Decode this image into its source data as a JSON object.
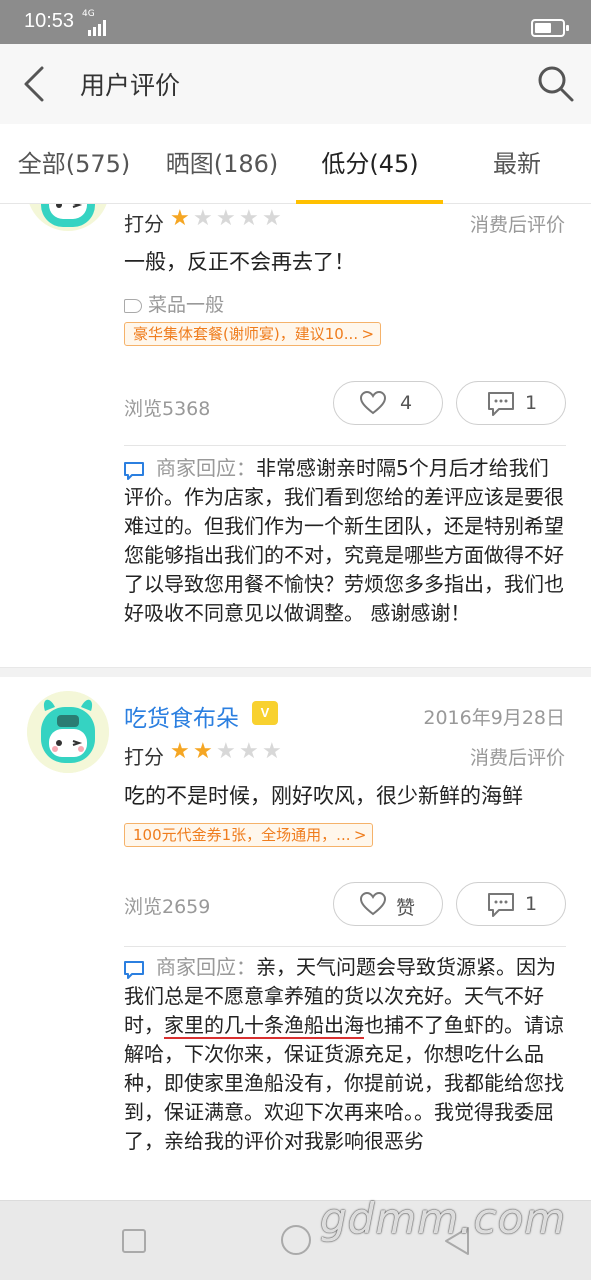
{
  "status_bar": {
    "time": "10:53",
    "network": "4G"
  },
  "header": {
    "title": "用户评价"
  },
  "tabs": [
    {
      "label": "全部(575)"
    },
    {
      "label": "晒图(186)"
    },
    {
      "label": "低分(45)",
      "active": true
    },
    {
      "label": "最新"
    }
  ],
  "reviews": [
    {
      "score_label": "打分",
      "stars": 1,
      "tag": "消费后评价",
      "text": "一般，反正不会再去了！",
      "dish_tag": "菜品一般",
      "deal": "豪华集体套餐(谢师宴)，建议10...",
      "views": "浏览5368",
      "like_count": "4",
      "comment_count": "1",
      "reply_label": "商家回应：",
      "reply_text": "非常感谢亲时隔5个月后才给我们评价。作为店家，我们看到您给的差评应该是要很难过的。但我们作为一个新生团队，还是特别希望您能够指出我们的不对，究竟是哪些方面做得不好了以导致您用餐不愉快？劳烦您多多指出，我们也好吸收不同意见以做调整。 感谢感谢！"
    },
    {
      "username": "吃货食布朵",
      "vip": "V",
      "date": "2016年9月28日",
      "score_label": "打分",
      "stars": 2,
      "tag": "消费后评价",
      "text": "吃的不是时候，刚好吹风，很少新鲜的海鲜",
      "deal": "100元代金券1张，全场通用，...",
      "views": "浏览2659",
      "like_label": "赞",
      "comment_count": "1",
      "reply_label": "商家回应：",
      "reply_text_a": "亲，天气问题会导致货源紧。因为我们总是不愿意拿养殖的货以次充好。天气不好时，",
      "reply_text_b": "家里的几十条渔船出海",
      "reply_text_c": "也捕不了鱼虾的。请谅解哈，下次你来，保证货源充足，你想吃什么品种，即使家里渔船没有，你提前说，我都能给您找到，保证满意。欢迎下次再来哈。。我觉得我委屈了，亲给我的评价对我影响很恶劣"
    }
  ],
  "watermark": "gdmm.com",
  "colors": {
    "accent": "#ffc000",
    "star": "#f5a623",
    "link": "#2b7fe0",
    "chip": "#ef7d1e"
  }
}
